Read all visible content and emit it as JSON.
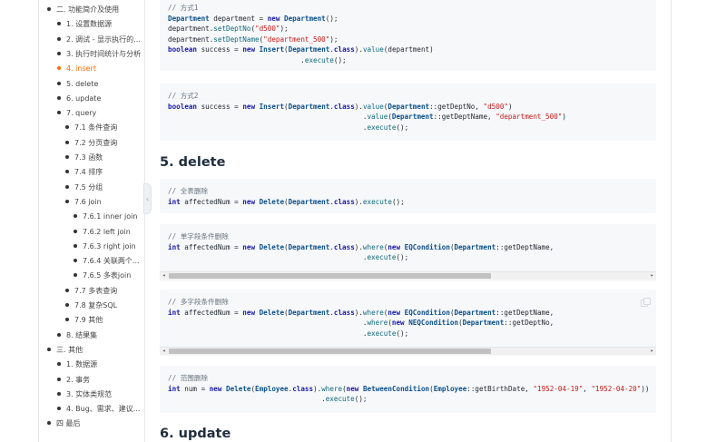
{
  "sidebar": {
    "items": [
      {
        "label": "二. 功能简介及使用",
        "active": false
      },
      {
        "label": "1. 设置数据源",
        "active": false
      },
      {
        "label": "2. 调试 - 显示执行的...",
        "active": false
      },
      {
        "label": "3. 执行时间统计与分析",
        "active": false
      },
      {
        "label": "4. insert",
        "active": true
      },
      {
        "label": "5. delete",
        "active": false
      },
      {
        "label": "6. update",
        "active": false
      },
      {
        "label": "7. query",
        "active": false
      },
      {
        "label": "7.1 条件查询",
        "active": false
      },
      {
        "label": "7.2 分页查询",
        "active": false
      },
      {
        "label": "7.3 函数",
        "active": false
      },
      {
        "label": "7.4 排序",
        "active": false
      },
      {
        "label": "7.5 分组",
        "active": false
      },
      {
        "label": "7.6 join",
        "active": false
      },
      {
        "label": "7.6.1 inner join",
        "active": false
      },
      {
        "label": "7.6.2 left join",
        "active": false
      },
      {
        "label": "7.6.3 right join",
        "active": false
      },
      {
        "label": "7.6.4 关联两个...",
        "active": false
      },
      {
        "label": "7.6.5 多表join",
        "active": false
      },
      {
        "label": "7.7 多表查询",
        "active": false
      },
      {
        "label": "7.8 复杂SQL",
        "active": false
      },
      {
        "label": "7.9 其他",
        "active": false
      },
      {
        "label": "8. 结果集",
        "active": false
      },
      {
        "label": "三. 其他",
        "active": false
      },
      {
        "label": "1. 数据源",
        "active": false
      },
      {
        "label": "2. 事务",
        "active": false
      },
      {
        "label": "3. 实体类规范",
        "active": false
      },
      {
        "label": "4. Bug、需求、建议...",
        "active": false
      },
      {
        "label": "四 最后",
        "active": false
      }
    ]
  },
  "headings": {
    "delete": "5. delete",
    "update": "6. update"
  },
  "code": {
    "insert1": [
      {
        "t": "// 方式1"
      },
      {
        "t": "Department department = new Department();"
      },
      {
        "t": "department.setDeptNo(\"d500\");"
      },
      {
        "t": "department.setDeptName(\"department_500\");"
      },
      {
        "t": "boolean success = new Insert(Department.class).value(department)"
      },
      {
        "t": "                                .execute();"
      }
    ],
    "insert2": [
      {
        "t": "// 方式2"
      },
      {
        "t": "boolean success = new Insert(Department.class).value(Department::getDeptNo, \"d500\")"
      },
      {
        "t": "                                               .value(Department::getDeptName, \"department_500\")"
      },
      {
        "t": "                                               .execute();"
      }
    ],
    "delete1": [
      {
        "t": "// 全表删除"
      },
      {
        "t": "int affectedNum = new Delete(Department.class).execute();"
      }
    ],
    "delete2": [
      {
        "t": "// 单字段条件删除"
      },
      {
        "t": "int affectedNum = new Delete(Department.class).where(new EQCondition(Department::getDeptName,"
      },
      {
        "t": "                                               .execute();"
      }
    ],
    "delete3": [
      {
        "t": "// 多字段条件删除"
      },
      {
        "t": "int affectedNum = new Delete(Department.class).where(new EQCondition(Department::getDeptName,"
      },
      {
        "t": "                                               .where(new NEQCondition(Department::getDeptNo,"
      },
      {
        "t": "                                               .execute();"
      }
    ],
    "delete4": [
      {
        "t": "// 范围删除"
      },
      {
        "t": "int num = new Delete(Employee.class).where(new BetweenCondition(Employee::getBirthDate, \"1952-04-19\", \"1952-04-20\"))"
      },
      {
        "t": "                                     .execute();"
      }
    ]
  },
  "colors": {
    "accent": "#ff6a00",
    "code_bg": "#f6f8fa",
    "keyword": "#1a1aa6",
    "string": "#c41a16",
    "comment": "#6a737d"
  }
}
